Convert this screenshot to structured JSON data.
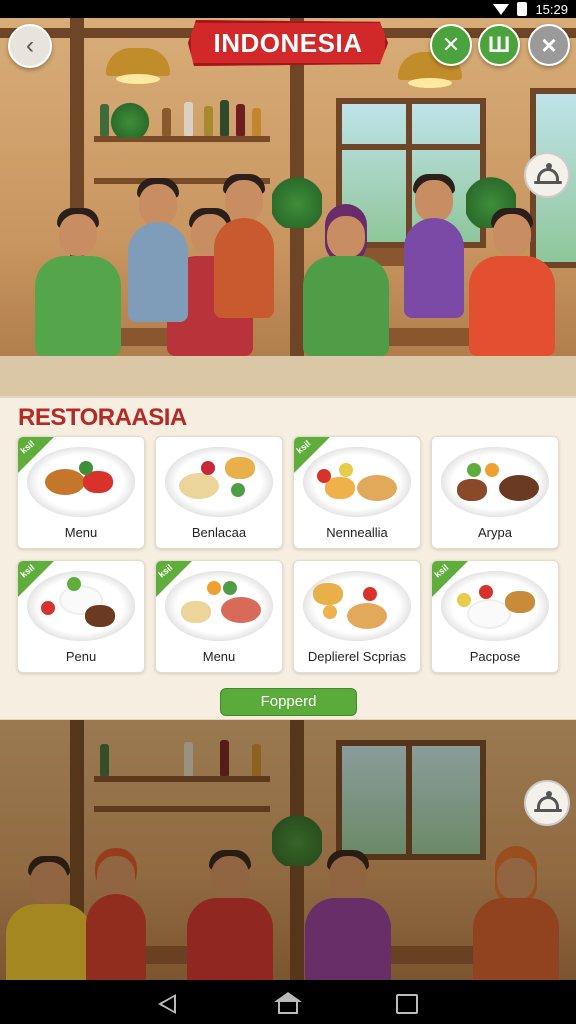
{
  "status_bar": {
    "time": "15:29"
  },
  "header": {
    "title": "INDONESIA",
    "back_icon": "chevron-left-icon",
    "actions": [
      "crossed-utensils-icon",
      "fork-icon",
      "close-icon"
    ]
  },
  "side_buttons": [
    "cloche-icon",
    "cloche-icon"
  ],
  "menu_panel": {
    "title": "RESTORAASIA",
    "button_label": "Fopperd",
    "items": [
      {
        "label": "Menu",
        "badge": "ksil"
      },
      {
        "label": "Benlacaa",
        "badge": ""
      },
      {
        "label": "Nenneallia",
        "badge": "ksil"
      },
      {
        "label": "Arypa",
        "badge": ""
      },
      {
        "label": "Penu",
        "badge": "ksil"
      },
      {
        "label": "Menu",
        "badge": "ksil"
      },
      {
        "label": "Deplierel Scprias",
        "badge": ""
      },
      {
        "label": "Pacpose",
        "badge": "ksil"
      }
    ]
  },
  "colors": {
    "banner_red": "#d2282a",
    "title_red": "#b52a25",
    "accent_green": "#5bab3b",
    "panel_bg": "#f6efe1"
  }
}
